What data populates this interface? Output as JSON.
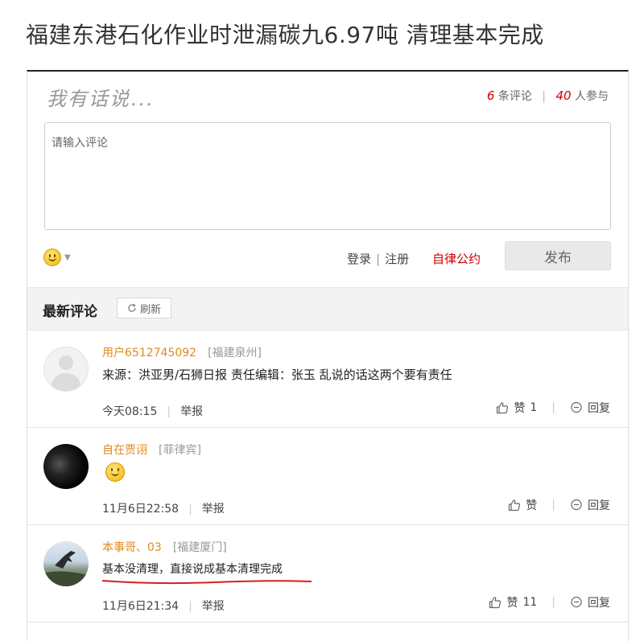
{
  "headline": "福建东港石化作业时泄漏碳九6.97吨 清理基本完成",
  "comment_box": {
    "prompt": "我有话说...",
    "comment_count": "6",
    "comment_count_label": "条评论",
    "participant_count": "40",
    "participant_label": "人参与",
    "placeholder": "请输入评论",
    "login": "登录",
    "register": "注册",
    "rules": "自律公约",
    "publish": "发布"
  },
  "latest": {
    "title": "最新评论",
    "refresh": "刷新"
  },
  "comments": [
    {
      "user": "用户6512745092",
      "location": "[福建泉州]",
      "text": "来源：洪亚男/石狮日报  责任编辑：张玉  乱说的话这两个要有责任",
      "time": "今天08:15",
      "report": "举报",
      "like_label": "赞",
      "like_count": "1",
      "reply": "回复"
    },
    {
      "user": "自在贾诩",
      "location": "[菲律宾]",
      "text": "",
      "time": "11月6日22:58",
      "report": "举报",
      "like_label": "赞",
      "like_count": "",
      "reply": "回复"
    },
    {
      "user": "本事哥、03",
      "location": "[福建厦门]",
      "text": "基本没清理，直接说成基本清理完成",
      "time": "11月6日21:34",
      "report": "举报",
      "like_label": "赞",
      "like_count": "11",
      "reply": "回复"
    }
  ],
  "icons": {
    "emoji": "smiley-icon",
    "refresh": "refresh-icon",
    "like": "thumbs-up-icon",
    "reply": "reply-bubble-icon"
  },
  "colors": {
    "accent_red": "#cc0000",
    "username_orange": "#e08a1e",
    "underline_red": "#d42020"
  }
}
